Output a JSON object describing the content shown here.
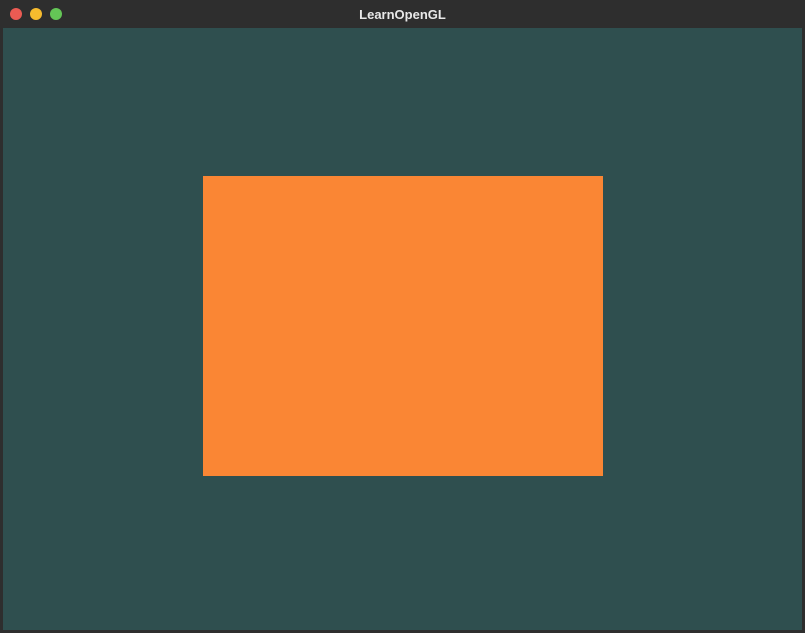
{
  "window": {
    "title": "LearnOpenGL"
  },
  "traffic_lights": {
    "close_color": "#eb5b53",
    "minimize_color": "#f6bb2e",
    "maximize_color": "#64c656"
  },
  "viewport": {
    "clear_color": "#2f4f4f",
    "rectangle_color": "#fa8634"
  }
}
